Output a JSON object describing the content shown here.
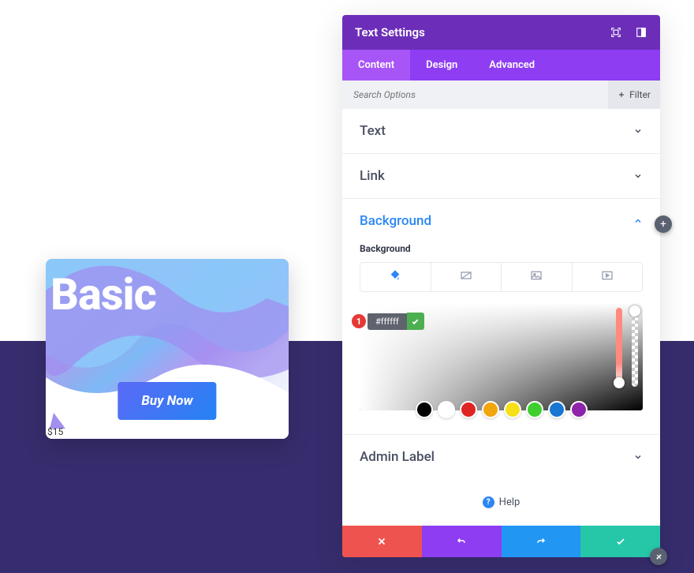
{
  "card": {
    "title": "Basic",
    "button": "Buy Now",
    "price": "$15"
  },
  "panel": {
    "title": "Text Settings",
    "tabs": {
      "content": "Content",
      "design": "Design",
      "advanced": "Advanced"
    },
    "search_placeholder": "Search Options",
    "filter": "Filter",
    "sections": {
      "text": "Text",
      "link": "Link",
      "background": "Background",
      "admin": "Admin Label"
    },
    "bg_label": "Background",
    "hex": "#ffffff",
    "annotation": "1",
    "swatches": [
      "#000000",
      "#ffffff",
      "#e02424",
      "#f2a60d",
      "#f7e018",
      "#3ecf2f",
      "#1976d2",
      "#8e24aa"
    ],
    "help": "Help"
  }
}
